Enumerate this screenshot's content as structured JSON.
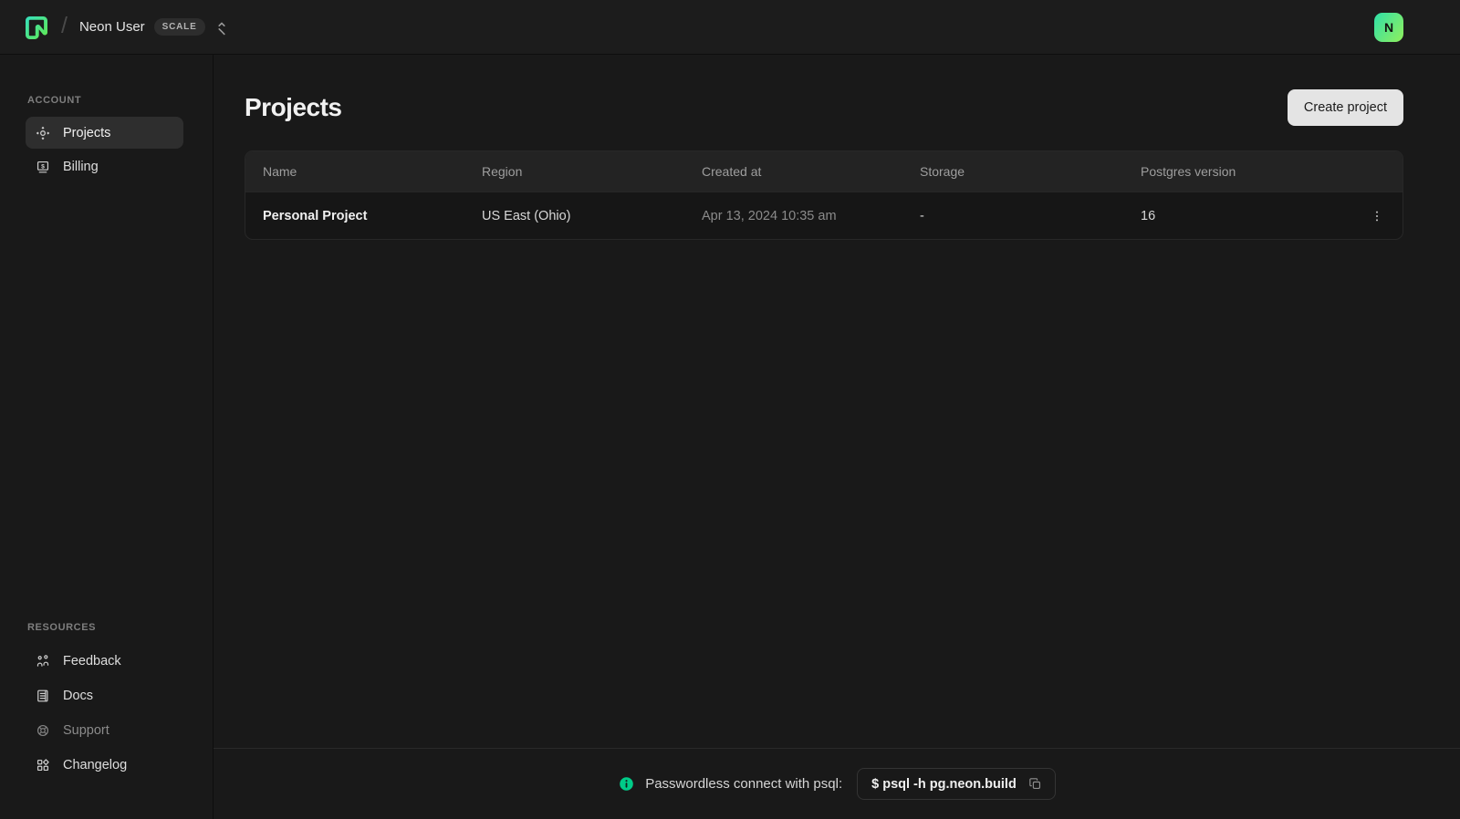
{
  "colors": {
    "accent": "#00e599",
    "avatar_gradient_from": "#2fe0a8",
    "avatar_gradient_to": "#90f05c",
    "info_green": "#00cc88",
    "active_item_bg": "#2e2e2e"
  },
  "topbar": {
    "org_name": "Neon User",
    "plan_badge": "SCALE",
    "avatar_initial": "N"
  },
  "sidebar": {
    "account_label": "ACCOUNT",
    "account_items": [
      {
        "label": "Projects",
        "icon": "projects-icon",
        "active": true
      },
      {
        "label": "Billing",
        "icon": "billing-icon",
        "active": false
      }
    ],
    "resources_label": "RESOURCES",
    "resource_items": [
      {
        "label": "Feedback",
        "icon": "feedback-icon",
        "dimmed": false
      },
      {
        "label": "Docs",
        "icon": "docs-icon",
        "dimmed": false
      },
      {
        "label": "Support",
        "icon": "support-icon",
        "dimmed": true
      },
      {
        "label": "Changelog",
        "icon": "changelog-icon",
        "dimmed": false
      }
    ]
  },
  "main": {
    "title": "Projects",
    "create_button_label": "Create project",
    "table": {
      "columns": [
        "Name",
        "Region",
        "Created at",
        "Storage",
        "Postgres version"
      ],
      "rows": [
        {
          "name": "Personal Project",
          "region": "US East (Ohio)",
          "created_at": "Apr 13, 2024 10:35 am",
          "storage": "-",
          "postgres_version": "16"
        }
      ]
    }
  },
  "footer": {
    "message": "Passwordless connect with psql:",
    "command": "$ psql -h pg.neon.build"
  }
}
